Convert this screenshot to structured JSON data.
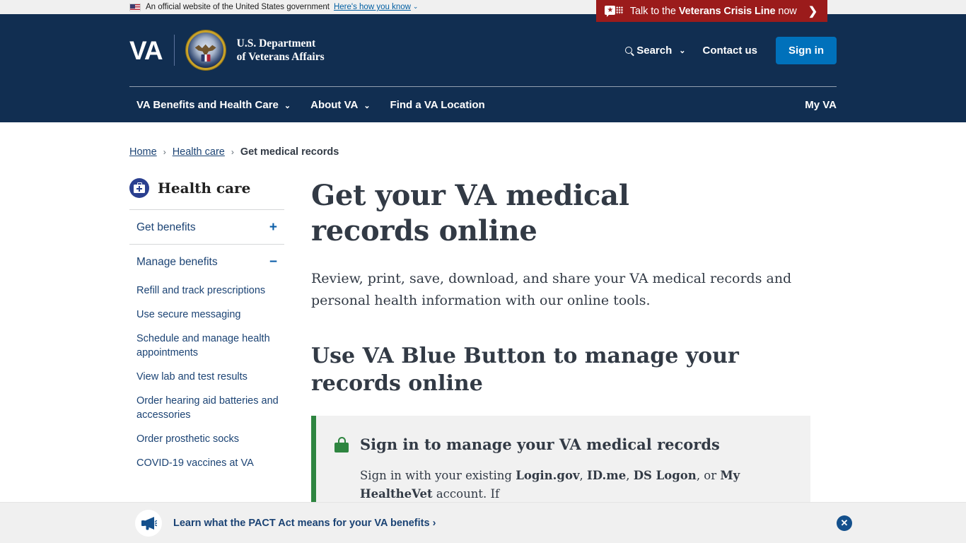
{
  "gov_banner": {
    "text": "An official website of the United States government",
    "how_link": "Here's how you know",
    "flag_icon": "us-flag-icon",
    "chevron": "⌄"
  },
  "crisis_banner": {
    "prefix": "Talk to the ",
    "bold": "Veterans Crisis Line",
    "suffix": " now",
    "arrow": "❯",
    "icon": "crisis-chat-icon",
    "bg_color": "#9b1b1b"
  },
  "header": {
    "va_mark": "VA",
    "seal_icon": "va-seal-icon",
    "department_line1": "U.S. Department",
    "department_line2": "of Veterans Affairs",
    "search_label": "Search",
    "search_icon": "search-icon",
    "search_chevron": "⌄",
    "contact_label": "Contact us",
    "signin_label": "Sign in",
    "signin_color": "#0071bb",
    "bg_color": "#112e51"
  },
  "main_nav": {
    "items": [
      {
        "label": "VA Benefits and Health Care",
        "has_chevron": true
      },
      {
        "label": "About VA",
        "has_chevron": true
      },
      {
        "label": "Find a VA Location",
        "has_chevron": false
      }
    ],
    "my_va_label": "My VA",
    "chevron": "⌄"
  },
  "breadcrumb": {
    "items": [
      {
        "label": "Home",
        "current": false
      },
      {
        "label": "Health care",
        "current": false
      },
      {
        "label": "Get medical records",
        "current": true
      }
    ],
    "separator": "›"
  },
  "sidebar": {
    "title": "Health care",
    "icon": "health-care-bag-icon",
    "accordions": [
      {
        "label": "Get benefits",
        "toggle": "+",
        "expanded": false
      },
      {
        "label": "Manage benefits",
        "toggle": "−",
        "expanded": true
      }
    ],
    "submenu": [
      "Refill and track prescriptions",
      "Use secure messaging",
      "Schedule and manage health appointments",
      "View lab and test results",
      "Order hearing aid batteries and accessories",
      "Order prosthetic socks",
      "COVID-19 vaccines at VA"
    ]
  },
  "main": {
    "page_title": "Get your VA medical records online",
    "intro": "Review, print, save, download, and share your VA medical records and personal health information with our online tools.",
    "section_title": "Use VA Blue Button to manage your records online",
    "alert": {
      "lock_icon": "lock-icon",
      "accent_color": "#2e8540",
      "title": "Sign in to manage your VA medical records",
      "body_prefix": "Sign in with your existing ",
      "body_accounts": [
        "Login.gov",
        "ID.me",
        "DS Logon",
        "My HealtheVet"
      ],
      "body_suffix": " account. If"
    }
  },
  "pact_banner": {
    "icon": "megaphone-icon",
    "link_label": "Learn what the PACT Act means for your VA benefits",
    "arrow": "›",
    "close_icon": "close-icon",
    "close_glyph": "✕"
  }
}
